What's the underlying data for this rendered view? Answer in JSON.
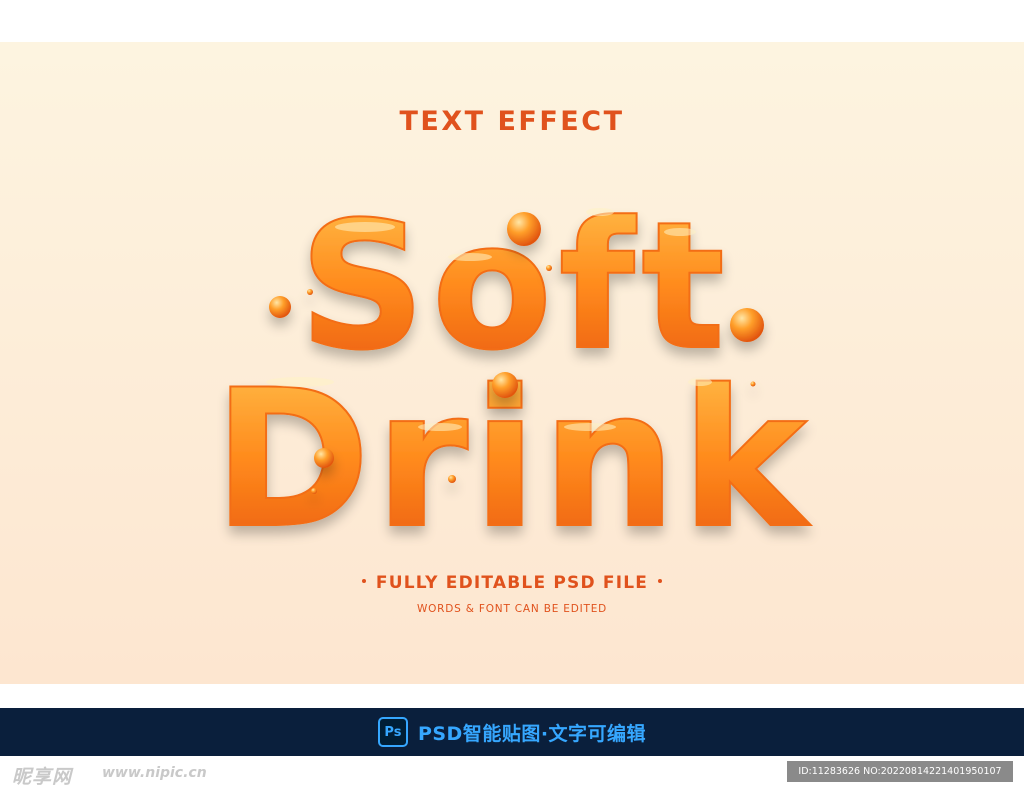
{
  "poster": {
    "title": "TEXT EFFECT",
    "headline_line1": "Soft",
    "headline_line2": "Drink",
    "subtitle": "FULLY EDITABLE PSD FILE",
    "tagline": "WORDS & FONT CAN BE EDITED",
    "colors": {
      "accent": "#e0521d",
      "background_top": "#fdf4e0",
      "background_bottom": "#fde6d0",
      "liquid_light": "#ffc24d",
      "liquid_mid": "#ff8a1c",
      "liquid_dark": "#e8560f"
    }
  },
  "banner": {
    "icon_text": "Ps",
    "icon_name": "photoshop-icon",
    "text": "PSD智能贴图·文字可编辑",
    "bg_color": "#0a1f3c",
    "text_color": "#36a7ff"
  },
  "footer": {
    "watermark_logo": "昵享网",
    "watermark_url": "www.nipic.cn",
    "image_id": "ID:11283626 NO:20220814221401950107"
  }
}
